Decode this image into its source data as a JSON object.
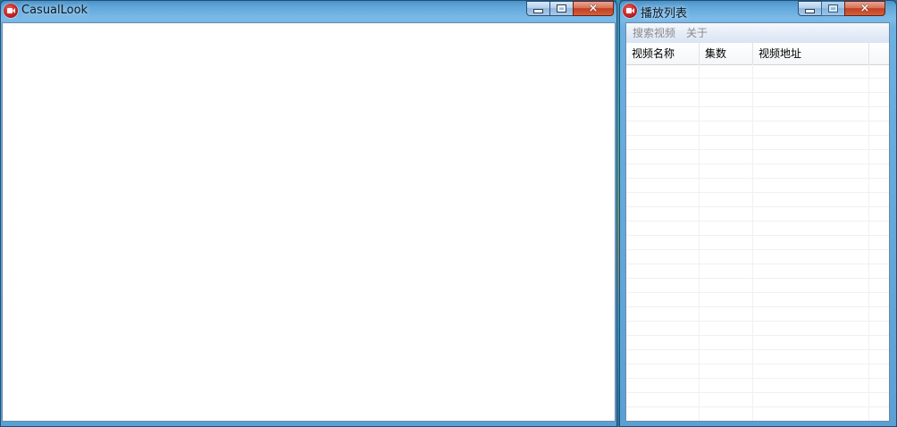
{
  "main_window": {
    "title": "CasualLook",
    "icon": "video-camera-icon",
    "controls": {
      "minimize": "minimize-icon",
      "maximize": "maximize-icon",
      "close": "×"
    }
  },
  "playlist_window": {
    "title": "播放列表",
    "icon": "video-camera-icon",
    "controls": {
      "minimize": "minimize-icon",
      "maximize": "maximize-icon",
      "close": "×"
    },
    "menu": [
      "搜索视频",
      "关于"
    ],
    "list": {
      "columns": [
        "视频名称",
        "集数",
        "视频地址"
      ],
      "rows": []
    }
  },
  "colors": {
    "title_bar": "#5fa5d8",
    "close_button": "#c2401f",
    "menu_text_disabled": "#8a8a8a"
  }
}
